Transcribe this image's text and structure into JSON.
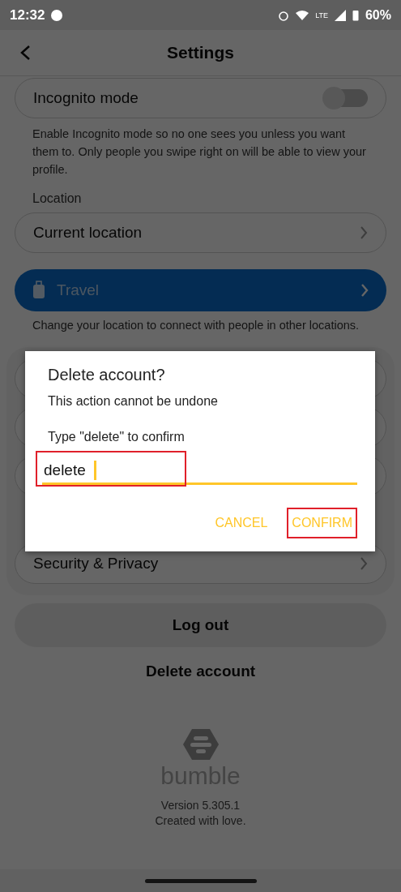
{
  "status_bar": {
    "time": "12:32",
    "network": "LTE",
    "battery": "60%"
  },
  "header": {
    "title": "Settings"
  },
  "incognito": {
    "label": "Incognito mode",
    "on": false,
    "description": "Enable Incognito mode so no one sees you unless you want them to. Only people you swipe right on will be able to view your profile."
  },
  "location": {
    "heading": "Location",
    "current": "Current location",
    "travel": "Travel",
    "travel_description": "Change your location to connect with people in other locations."
  },
  "settings_rows": [
    {
      "label": ""
    },
    {
      "label": ""
    },
    {
      "label": ""
    },
    {
      "label": "Security & Privacy"
    }
  ],
  "log_out": "Log out",
  "delete_account": "Delete account",
  "footer": {
    "brand": "bumble",
    "version": "Version 5.305.1",
    "tagline": "Created with love."
  },
  "dialog": {
    "title": "Delete account?",
    "message": "This action cannot be undone",
    "prompt": "Type \"delete\" to confirm",
    "value": "delete",
    "field_highlighted": true,
    "buttons": [
      {
        "label": "CANCEL",
        "highlighted": false
      },
      {
        "label": "CONFIRM",
        "highlighted": true
      }
    ]
  }
}
